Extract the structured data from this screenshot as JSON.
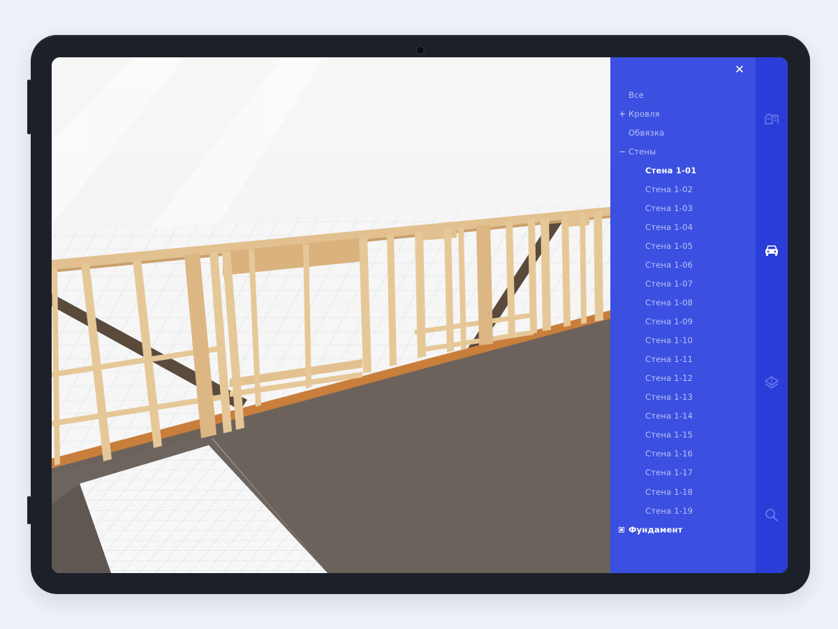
{
  "tree": {
    "close_label": "✕",
    "items": [
      {
        "label": "Все",
        "marker": ""
      },
      {
        "label": "Кровля",
        "marker": "+"
      },
      {
        "label": "Обвязка",
        "marker": ""
      },
      {
        "label": "Стены",
        "marker": "−"
      }
    ],
    "walls": [
      "Стена 1-01",
      "Стена 1-02",
      "Стена 1-03",
      "Стена 1-04",
      "Стена 1-05",
      "Стена 1-06",
      "Стена 1-07",
      "Стена 1-08",
      "Стена 1-09",
      "Стена 1-10",
      "Стена 1-11",
      "Стена 1-12",
      "Стена 1-13",
      "Стена 1-14",
      "Стена 1-15",
      "Стена 1-16",
      "Стена 1-17",
      "Стена 1-18",
      "Стена 1-19"
    ],
    "selected_wall": "Стена 1-01",
    "foundation": "Фундамент"
  },
  "rail": {
    "icons": [
      "house-icon",
      "car-icon",
      "layers-icon",
      "search-icon"
    ],
    "active_icon": "car-icon"
  },
  "colors": {
    "panel": "#3b4fe0",
    "rail": "#2a3dd8",
    "frame": "#1c2029",
    "timber": "#e2c08f",
    "floor": "#6b625c"
  }
}
